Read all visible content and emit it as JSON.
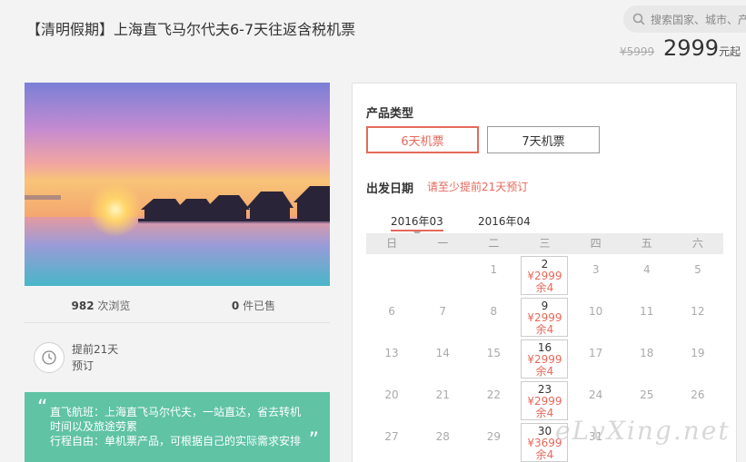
{
  "header": {
    "title": "【清明假期】上海直飞马尔代夫6-7天往返含税机票",
    "search_placeholder": "搜索国家、城市、产",
    "old_price": "¥5999",
    "price": "2999",
    "price_suffix": "元起"
  },
  "stats": {
    "views_count": "982",
    "views_label": " 次浏览",
    "sold_count": "0",
    "sold_label": " 件已售"
  },
  "advance": {
    "line1": "提前21天",
    "line2": "预订"
  },
  "quote": {
    "line1": "直飞航班：上海直飞马尔代夫，一站直达，省去转机",
    "line2": "时间以及旅途劳累",
    "line3": "行程自由：单机票产品，可根据自己的实际需求安排"
  },
  "product": {
    "label": "产品类型",
    "options": [
      {
        "label": "6天机票",
        "active": true
      },
      {
        "label": "7天机票",
        "active": false
      }
    ]
  },
  "departure": {
    "label": "出发日期",
    "notice": "请至少提前21天预订"
  },
  "months": [
    {
      "label": "2016年03",
      "active": true
    },
    {
      "label": "2016年04",
      "active": false
    }
  ],
  "weekdays": [
    "日",
    "一",
    "二",
    "三",
    "四",
    "五",
    "六"
  ],
  "calendar": {
    "weeks": [
      [
        null,
        null,
        {
          "day": "1"
        },
        {
          "day": "2",
          "price": "¥2999",
          "stock": "余4"
        },
        {
          "day": "3"
        },
        {
          "day": "4"
        },
        {
          "day": "5"
        }
      ],
      [
        {
          "day": "6"
        },
        {
          "day": "7"
        },
        {
          "day": "8"
        },
        {
          "day": "9",
          "price": "¥2999",
          "stock": "余4"
        },
        {
          "day": "10"
        },
        {
          "day": "11"
        },
        {
          "day": "12"
        }
      ],
      [
        {
          "day": "13"
        },
        {
          "day": "14"
        },
        {
          "day": "15"
        },
        {
          "day": "16",
          "price": "¥2999",
          "stock": "余4"
        },
        {
          "day": "17"
        },
        {
          "day": "18"
        },
        {
          "day": "19"
        }
      ],
      [
        {
          "day": "20"
        },
        {
          "day": "21"
        },
        {
          "day": "22"
        },
        {
          "day": "23",
          "price": "¥2999",
          "stock": "余4"
        },
        {
          "day": "24"
        },
        {
          "day": "25"
        },
        {
          "day": "26"
        }
      ],
      [
        {
          "day": "27"
        },
        {
          "day": "28"
        },
        {
          "day": "29"
        },
        {
          "day": "30",
          "price": "¥3699",
          "stock": "余4"
        },
        {
          "day": "31"
        },
        null,
        null
      ]
    ]
  },
  "watermark": "eLvXing.net",
  "colors": {
    "accent": "#e5695b",
    "quote_bg": "#5fc3a4"
  }
}
